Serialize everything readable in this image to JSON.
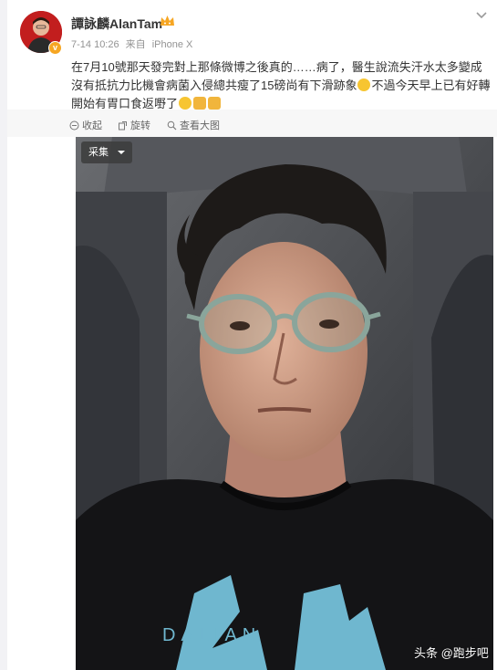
{
  "post": {
    "username": "譚詠麟AlanTam",
    "time": "7-14 10:26",
    "source_prefix": "来自",
    "source": "iPhone X",
    "verified_badge": "v",
    "text_1": "在7月10號那天發完對上那條微博之後真的……病了，醫生說流失汗水太多變成沒有抵抗力比機會病菌入侵總共瘦了15磅尚有下滑跡象",
    "text_2": "不過今天早上已有好轉開始有胃口食返嘢了",
    "emojis": [
      "smile-emoji",
      "muscle-emoji",
      "ok-hand-emoji"
    ]
  },
  "actions": {
    "collapse": "收起",
    "rotate": "旋转",
    "view_large": "查看大图"
  },
  "photo": {
    "collect_label": "采集",
    "shirt_text": "DALIAN"
  },
  "watermark": "头条 @跑步吧",
  "colors": {
    "accent_badge": "#f6a623",
    "text": "#333333",
    "muted": "#939393",
    "bar": "#f7f7f7"
  }
}
